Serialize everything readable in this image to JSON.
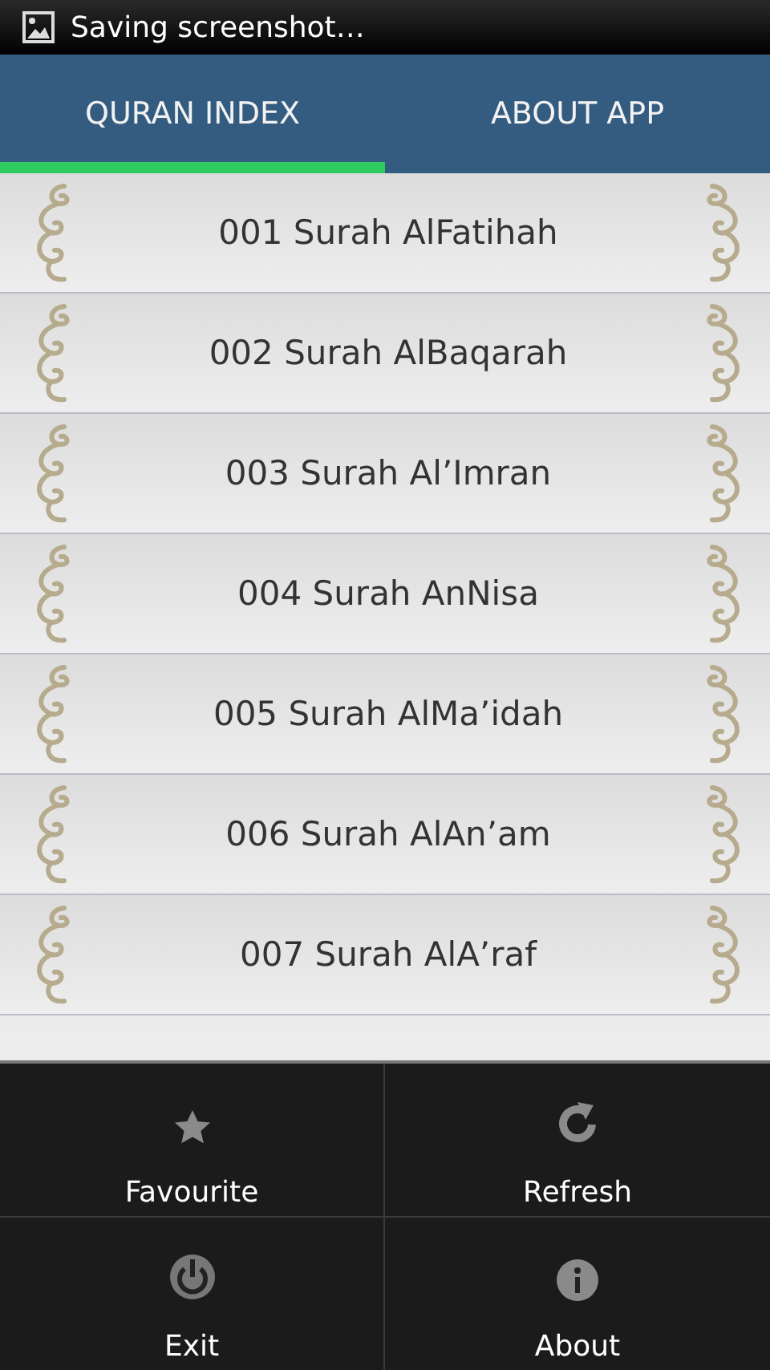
{
  "status_bar": {
    "notification": "Saving screenshot…"
  },
  "tabs": [
    {
      "label": "QURAN INDEX",
      "selected": true
    },
    {
      "label": "ABOUT APP",
      "selected": false
    }
  ],
  "surahs": [
    "001 Surah AlFatihah",
    "002 Surah AlBaqarah",
    "003 Surah Al’Imran",
    "004 Surah AnNisa",
    "005 Surah AlMa’idah",
    "006 Surah AlAn’am",
    "007 Surah AlA’raf"
  ],
  "menu": [
    {
      "kind": "star",
      "label": "Favourite"
    },
    {
      "kind": "refresh",
      "label": "Refresh"
    },
    {
      "kind": "power",
      "label": "Exit"
    },
    {
      "kind": "info",
      "label": "About"
    }
  ]
}
